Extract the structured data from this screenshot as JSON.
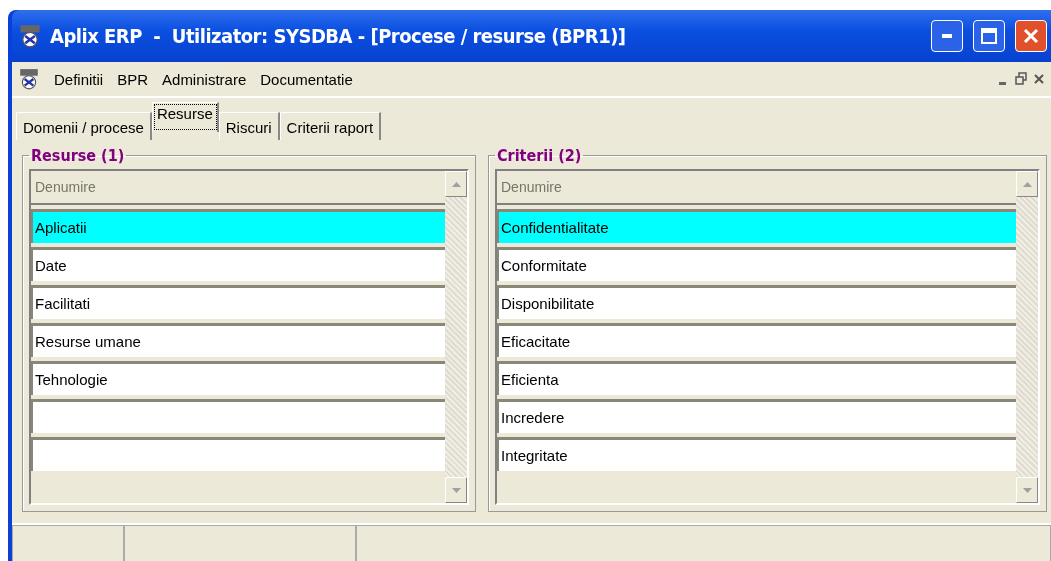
{
  "window": {
    "title": "Aplix ERP  -  Utilizator: SYSDBA - [Procese / resurse (BPR1)]"
  },
  "menu": [
    {
      "label": "Definitii"
    },
    {
      "label": "BPR"
    },
    {
      "label": "Administrare"
    },
    {
      "label": "Documentatie"
    }
  ],
  "tabs": [
    {
      "label": "Domenii / procese",
      "selected": false
    },
    {
      "label": "Resurse",
      "selected": true
    },
    {
      "label": "Riscuri",
      "selected": false
    },
    {
      "label": "Criterii raport",
      "selected": false
    }
  ],
  "panels": [
    {
      "title": "Resurse (1)",
      "column": "Denumire",
      "rows": [
        {
          "label": "Aplicatii",
          "selected": true
        },
        {
          "label": "Date",
          "selected": false
        },
        {
          "label": "Facilitati",
          "selected": false
        },
        {
          "label": "Resurse umane",
          "selected": false
        },
        {
          "label": "Tehnologie",
          "selected": false
        }
      ]
    },
    {
      "title": "Criterii (2)",
      "column": "Denumire",
      "rows": [
        {
          "label": "Confidentialitate",
          "selected": true
        },
        {
          "label": "Conformitate",
          "selected": false
        },
        {
          "label": "Disponibilitate",
          "selected": false
        },
        {
          "label": "Eficacitate",
          "selected": false
        },
        {
          "label": "Eficienta",
          "selected": false
        },
        {
          "label": "Incredere",
          "selected": false
        },
        {
          "label": "Integritate",
          "selected": false
        }
      ]
    }
  ]
}
